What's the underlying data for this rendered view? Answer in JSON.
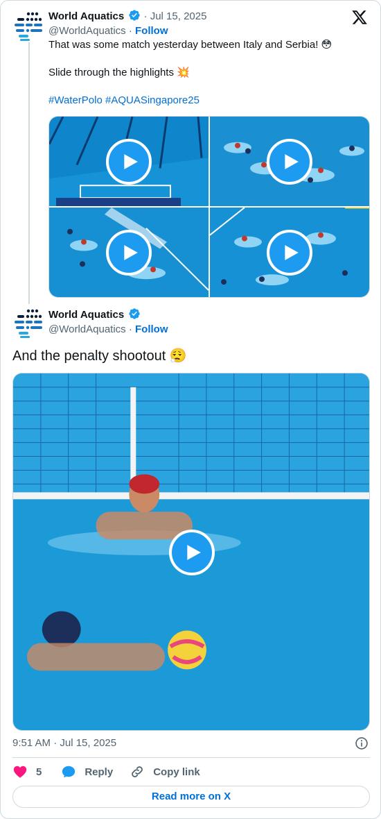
{
  "colors": {
    "accent": "#1d9bf0",
    "link": "#006fd6",
    "like": "#f91880",
    "muted": "#536471"
  },
  "quoted_tweet": {
    "author_name": "World Aquatics",
    "handle": "@WorldAquatics",
    "date": "Jul 15, 2025",
    "separator": "·",
    "follow_label": "Follow",
    "text_line_1": "That was some match yesterday between Italy and Serbia! 😳",
    "text_line_2": "Slide through the highlights 💥",
    "hashtag_1": "#WaterPolo",
    "hashtag_2": "#AQUASingapore25",
    "media_count": 4
  },
  "main_tweet": {
    "author_name": "World Aquatics",
    "handle": "@WorldAquatics",
    "separator": "·",
    "follow_label": "Follow",
    "text": "And the penalty shootout 😮‍💨",
    "timestamp": "9:51 AM · Jul 15, 2025"
  },
  "actions": {
    "like_count": "5",
    "reply_label": "Reply",
    "copy_link_label": "Copy link"
  },
  "read_more_label": "Read more on X",
  "icons": [
    "avatar-logo",
    "verified-badge-icon",
    "x-logo-icon",
    "play-icon",
    "info-icon",
    "heart-icon",
    "reply-bubble-icon",
    "link-icon"
  ]
}
